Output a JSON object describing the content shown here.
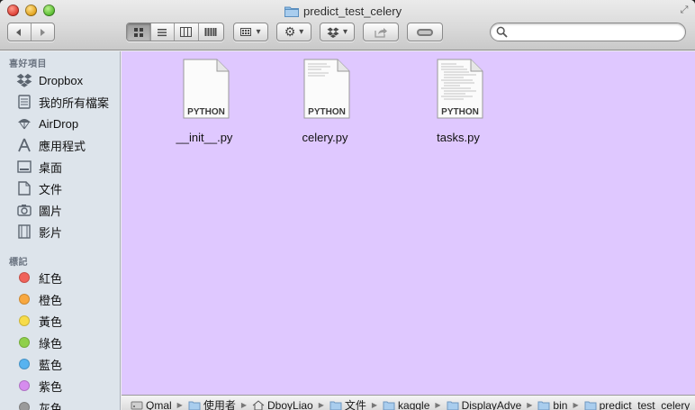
{
  "window": {
    "title": "predict_test_celery",
    "accent_color": "#dfc8ff"
  },
  "toolbar": {
    "back_icon": "chevron-left-icon",
    "forward_icon": "chevron-right-icon",
    "view_modes": [
      "icon-view",
      "list-view",
      "column-view",
      "cover-flow-view"
    ],
    "active_view": "icon-view",
    "search": {
      "value": "",
      "placeholder": ""
    }
  },
  "sidebar": {
    "favorites_header": "喜好項目",
    "favorites": [
      {
        "label": "Dropbox",
        "icon": "dropbox-icon"
      },
      {
        "label": "我的所有檔案",
        "icon": "all-files-icon"
      },
      {
        "label": "AirDrop",
        "icon": "airdrop-icon"
      },
      {
        "label": "應用程式",
        "icon": "applications-icon"
      },
      {
        "label": "桌面",
        "icon": "desktop-icon"
      },
      {
        "label": "文件",
        "icon": "documents-icon"
      },
      {
        "label": "圖片",
        "icon": "pictures-icon"
      },
      {
        "label": "影片",
        "icon": "movies-icon"
      }
    ],
    "tags_header": "標記",
    "tags": [
      {
        "label": "紅色",
        "color": "#f0625a"
      },
      {
        "label": "橙色",
        "color": "#f8a840"
      },
      {
        "label": "黃色",
        "color": "#f7dc4a"
      },
      {
        "label": "綠色",
        "color": "#8fd04a"
      },
      {
        "label": "藍色",
        "color": "#57b3f0"
      },
      {
        "label": "紫色",
        "color": "#d68cee"
      },
      {
        "label": "灰色",
        "color": "#9a9a9a"
      }
    ]
  },
  "files": [
    {
      "name": "__init__.py",
      "badge": "PYTHON",
      "has_text_preview": false
    },
    {
      "name": "celery.py",
      "badge": "PYTHON",
      "has_text_preview": true
    },
    {
      "name": "tasks.py",
      "badge": "PYTHON",
      "has_text_preview": true
    }
  ],
  "pathbar": {
    "crumbs": [
      {
        "label": "Qmal",
        "icon": "disk-icon"
      },
      {
        "label": "使用者",
        "icon": "folder-icon"
      },
      {
        "label": "DboyLiao",
        "icon": "home-icon"
      },
      {
        "label": "文件",
        "icon": "documents-folder-icon"
      },
      {
        "label": "kaggle",
        "icon": "folder-icon"
      },
      {
        "label": "DisplayAdve",
        "icon": "folder-icon"
      },
      {
        "label": "bin",
        "icon": "folder-icon"
      },
      {
        "label": "predict_test_celery",
        "icon": "folder-icon"
      }
    ]
  }
}
